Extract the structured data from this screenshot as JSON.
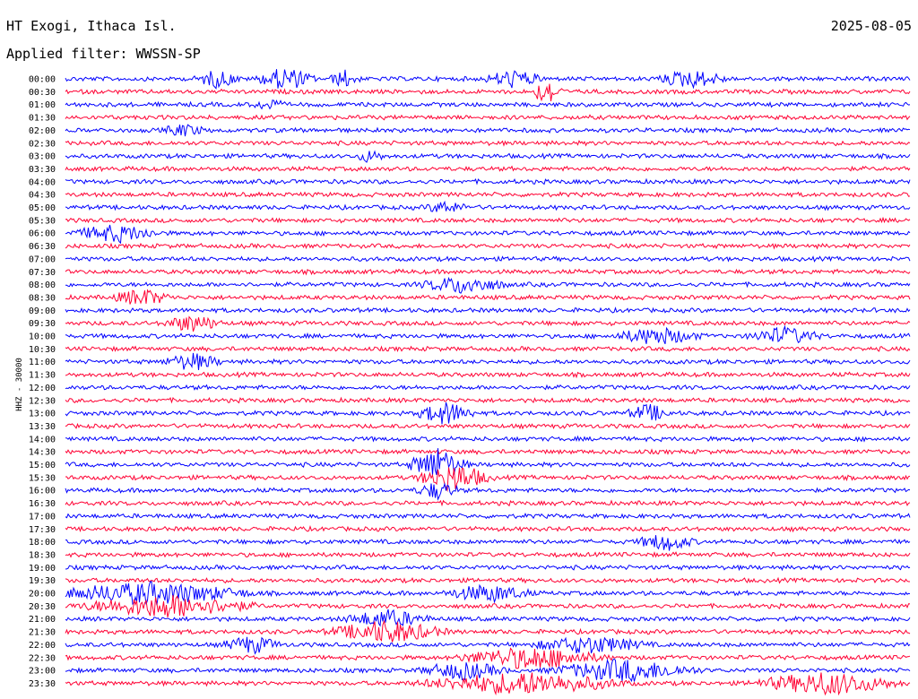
{
  "header": {
    "station": "HT Exogi, Ithaca Isl.",
    "date": "2025-08-05",
    "filter": "Applied filter: WWSSN-SP"
  },
  "y_axis_label": "HHZ - 30000",
  "colors": {
    "blue": "#0000ff",
    "red": "#ff0033",
    "text": "#000000"
  },
  "chart_data": {
    "type": "line",
    "title": "HT Exogi, Ithaca Isl.",
    "subtitle": "Applied filter: WWSSN-SP",
    "ylabel": "HHZ - 30000",
    "row_interval_minutes": 30,
    "row_labels": [
      "00:00",
      "00:30",
      "01:00",
      "01:30",
      "02:00",
      "02:30",
      "03:00",
      "03:30",
      "04:00",
      "04:30",
      "05:00",
      "05:30",
      "06:00",
      "06:30",
      "07:00",
      "07:30",
      "08:00",
      "08:30",
      "09:00",
      "09:30",
      "10:00",
      "10:30",
      "11:00",
      "11:30",
      "12:00",
      "12:30",
      "13:00",
      "13:30",
      "14:00",
      "14:30",
      "15:00",
      "15:30",
      "16:00",
      "16:30",
      "17:00",
      "17:30",
      "18:00",
      "18:30",
      "19:00",
      "19:30",
      "20:00",
      "20:30",
      "21:00",
      "21:30",
      "22:00",
      "22:30",
      "23:00",
      "23:30"
    ],
    "trace_colors": [
      "#0000ff",
      "#ff0033"
    ],
    "events": [
      {
        "row": 0,
        "pos": 0.18,
        "amp": 3,
        "width": 0.03
      },
      {
        "row": 0,
        "pos": 0.26,
        "amp": 4,
        "width": 0.04
      },
      {
        "row": 0,
        "pos": 0.33,
        "amp": 3,
        "width": 0.02
      },
      {
        "row": 0,
        "pos": 0.53,
        "amp": 3,
        "width": 0.04
      },
      {
        "row": 0,
        "pos": 0.74,
        "amp": 3,
        "width": 0.05
      },
      {
        "row": 1,
        "pos": 0.57,
        "amp": 5,
        "width": 0.02
      },
      {
        "row": 2,
        "pos": 0.24,
        "amp": 2,
        "width": 0.02
      },
      {
        "row": 4,
        "pos": 0.14,
        "amp": 2,
        "width": 0.03
      },
      {
        "row": 6,
        "pos": 0.36,
        "amp": 2,
        "width": 0.02
      },
      {
        "row": 10,
        "pos": 0.45,
        "amp": 2,
        "width": 0.03
      },
      {
        "row": 12,
        "pos": 0.06,
        "amp": 3,
        "width": 0.06
      },
      {
        "row": 16,
        "pos": 0.47,
        "amp": 3,
        "width": 0.06
      },
      {
        "row": 17,
        "pos": 0.09,
        "amp": 3,
        "width": 0.04
      },
      {
        "row": 19,
        "pos": 0.15,
        "amp": 3,
        "width": 0.04
      },
      {
        "row": 20,
        "pos": 0.7,
        "amp": 3,
        "width": 0.06
      },
      {
        "row": 20,
        "pos": 0.85,
        "amp": 3,
        "width": 0.05
      },
      {
        "row": 22,
        "pos": 0.15,
        "amp": 3,
        "width": 0.04
      },
      {
        "row": 26,
        "pos": 0.45,
        "amp": 4,
        "width": 0.04
      },
      {
        "row": 26,
        "pos": 0.69,
        "amp": 3,
        "width": 0.03
      },
      {
        "row": 30,
        "pos": 0.44,
        "amp": 6,
        "width": 0.04
      },
      {
        "row": 31,
        "pos": 0.46,
        "amp": 5,
        "width": 0.05
      },
      {
        "row": 32,
        "pos": 0.44,
        "amp": 3,
        "width": 0.03
      },
      {
        "row": 36,
        "pos": 0.71,
        "amp": 3,
        "width": 0.04
      },
      {
        "row": 40,
        "pos": 0.1,
        "amp": 4,
        "width": 0.14
      },
      {
        "row": 40,
        "pos": 0.5,
        "amp": 3,
        "width": 0.06
      },
      {
        "row": 41,
        "pos": 0.12,
        "amp": 4,
        "width": 0.12
      },
      {
        "row": 42,
        "pos": 0.38,
        "amp": 3,
        "width": 0.06
      },
      {
        "row": 43,
        "pos": 0.38,
        "amp": 4,
        "width": 0.08
      },
      {
        "row": 44,
        "pos": 0.22,
        "amp": 3,
        "width": 0.04
      },
      {
        "row": 44,
        "pos": 0.62,
        "amp": 3,
        "width": 0.08
      },
      {
        "row": 45,
        "pos": 0.55,
        "amp": 4,
        "width": 0.1
      },
      {
        "row": 46,
        "pos": 0.47,
        "amp": 3,
        "width": 0.06
      },
      {
        "row": 46,
        "pos": 0.66,
        "amp": 4,
        "width": 0.1
      },
      {
        "row": 47,
        "pos": 0.54,
        "amp": 4,
        "width": 0.14
      },
      {
        "row": 47,
        "pos": 0.9,
        "amp": 4,
        "width": 0.1
      }
    ]
  }
}
